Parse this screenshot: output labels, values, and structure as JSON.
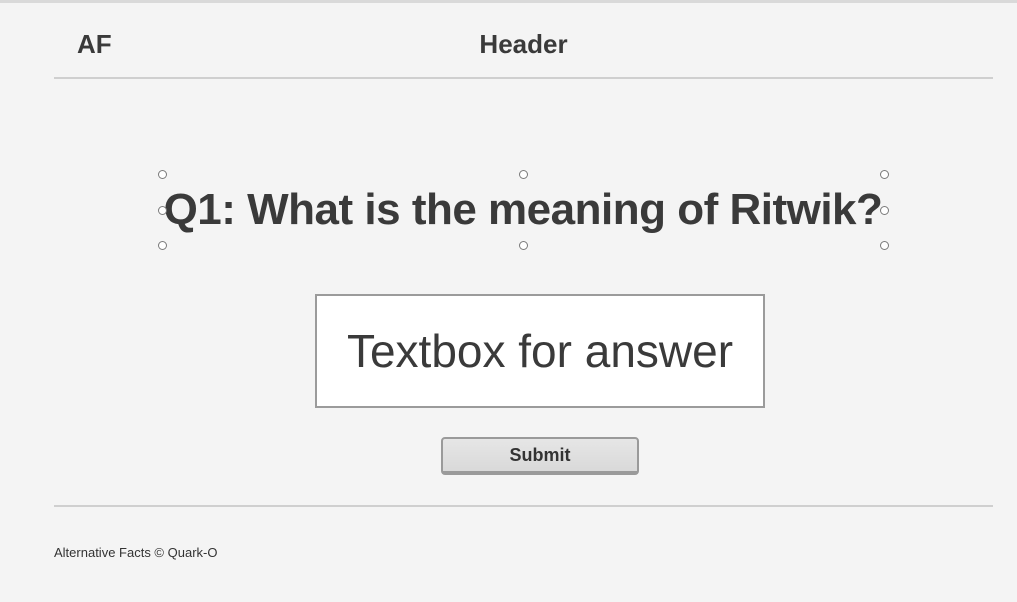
{
  "header": {
    "logo": "AF",
    "title": "Header"
  },
  "main": {
    "question": "Q1: What is the meaning of Ritwik?",
    "answer_placeholder": "Textbox for answer",
    "submit_label": "Submit"
  },
  "footer": {
    "text": "Alternative Facts © Quark-O"
  }
}
